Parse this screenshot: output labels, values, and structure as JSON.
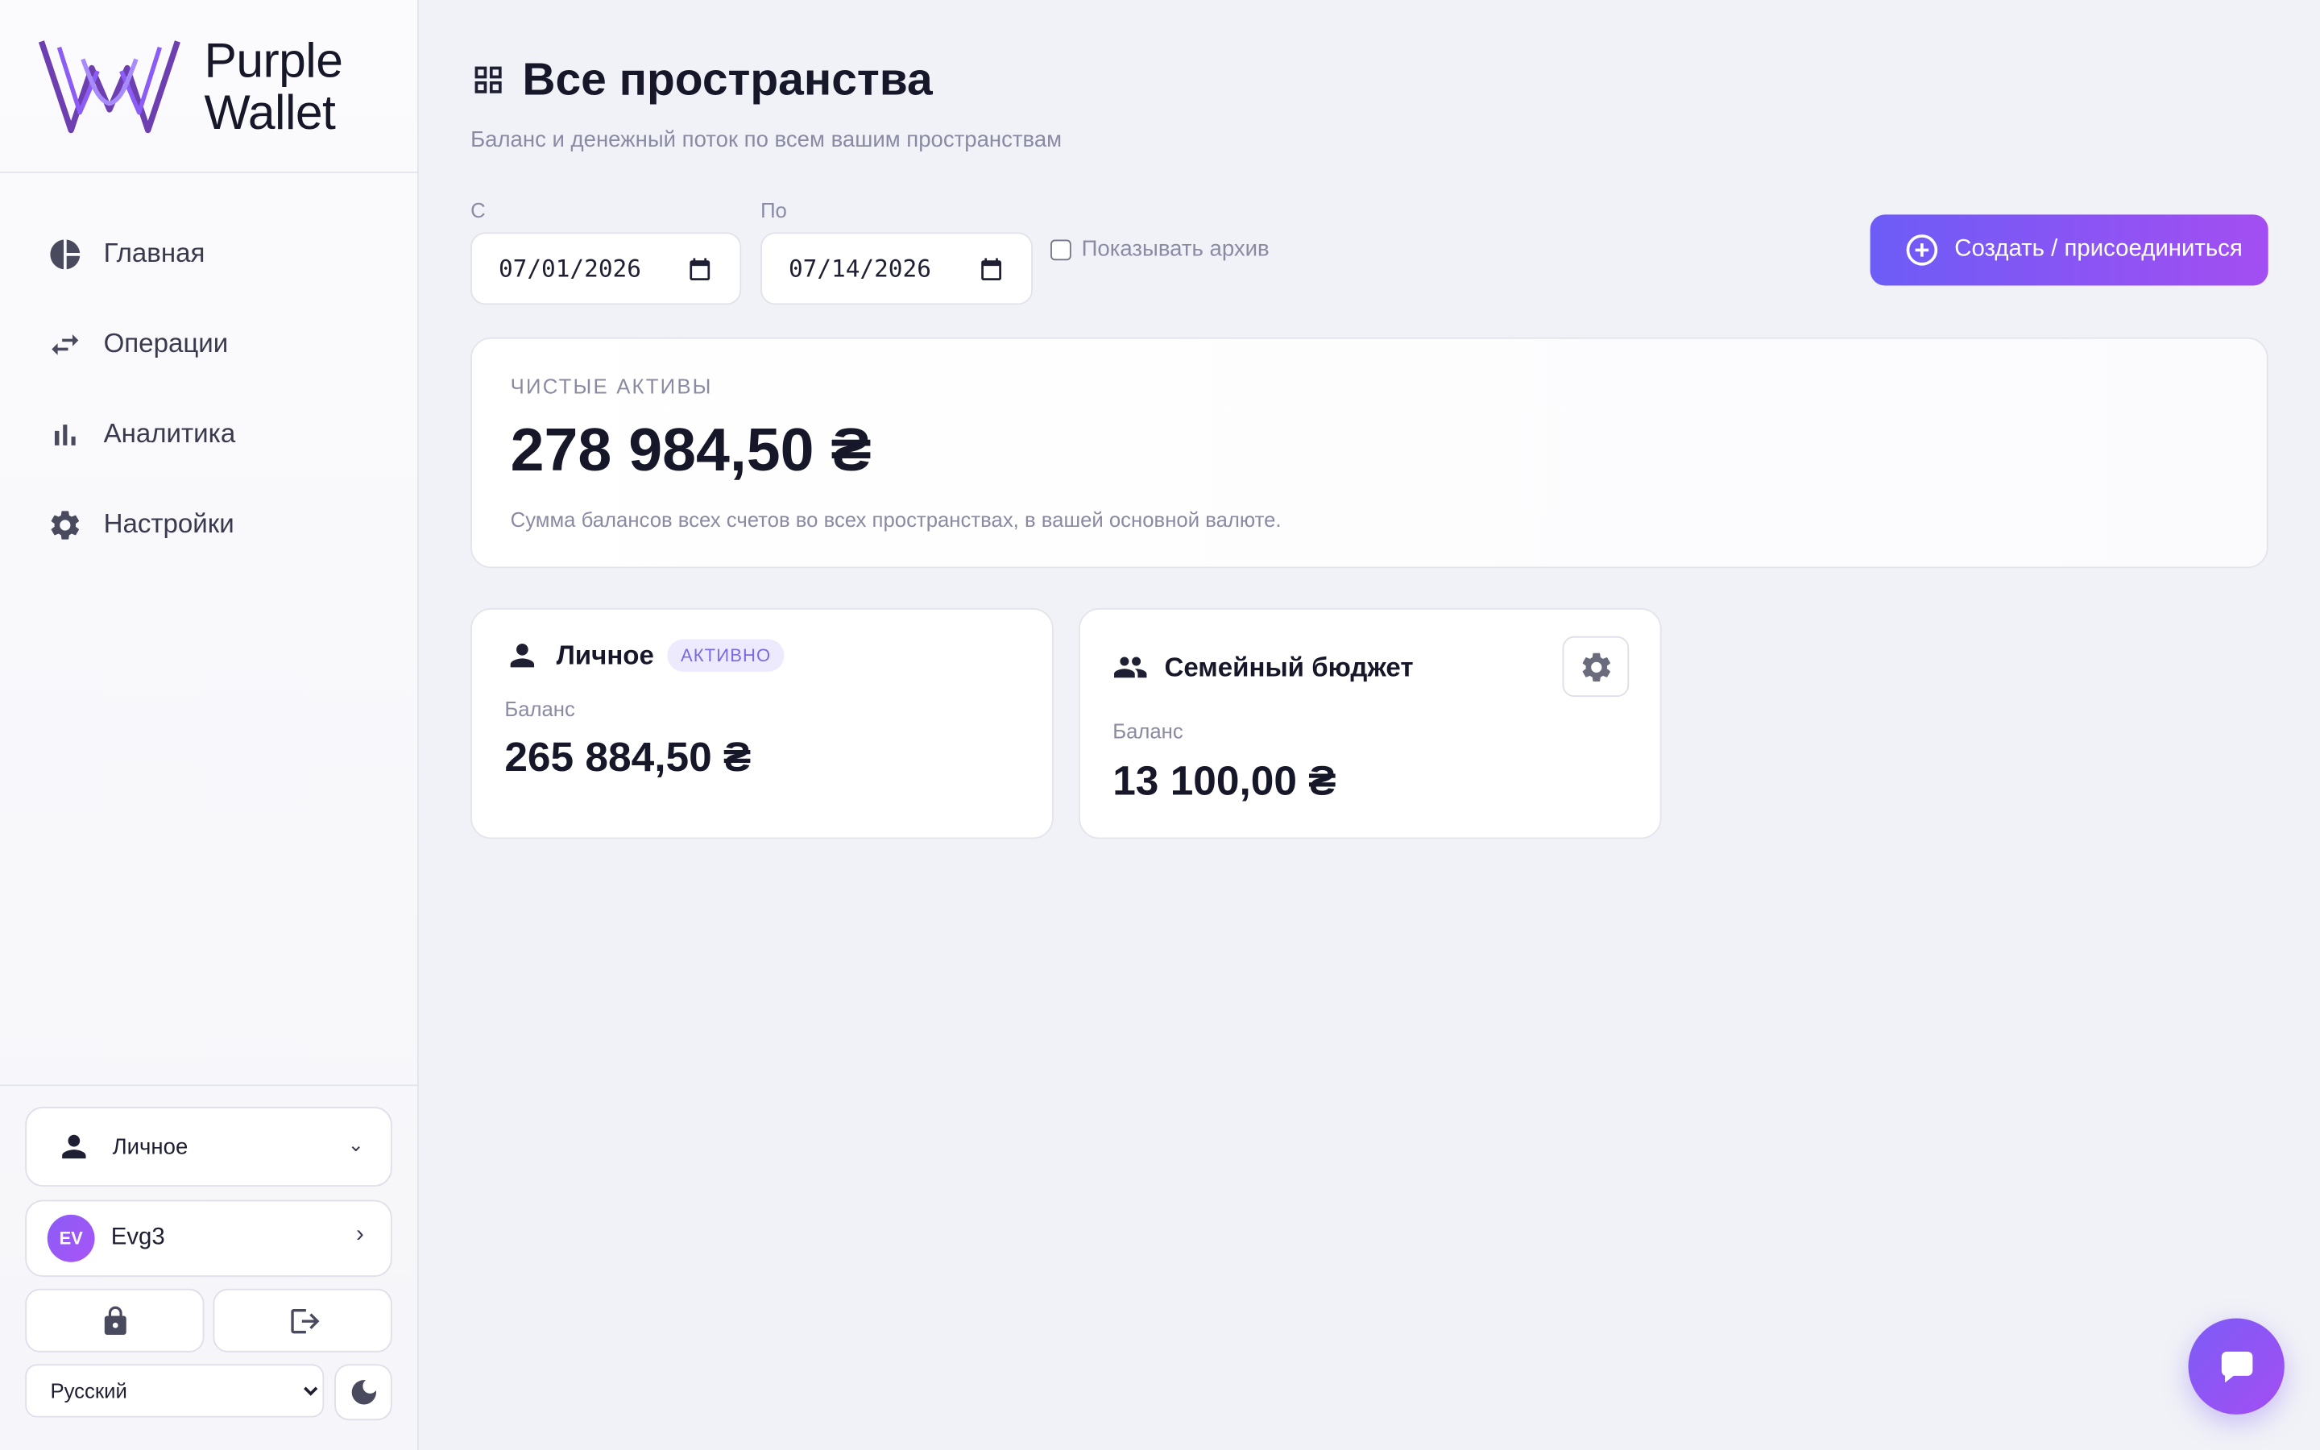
{
  "brand": {
    "line1": "Purple",
    "line2": "Wallet"
  },
  "nav": {
    "items": [
      {
        "label": "Главная",
        "icon": "pie-chart-icon"
      },
      {
        "label": "Операции",
        "icon": "swap-arrows-icon"
      },
      {
        "label": "Аналитика",
        "icon": "bar-chart-icon"
      },
      {
        "label": "Настройки",
        "icon": "gear-icon"
      }
    ]
  },
  "sidebar": {
    "space_select": {
      "label": "Личное"
    },
    "user": {
      "initials": "EV",
      "name": "Evg3"
    },
    "language": {
      "selected": "Русский",
      "options": [
        "Русский"
      ]
    }
  },
  "page": {
    "title": "Все пространства",
    "subtitle": "Баланс и денежный поток по всем вашим пространствам"
  },
  "filters": {
    "from_label": "С",
    "from_value": "07/01/2026",
    "to_label": "По",
    "to_value": "07/14/2026",
    "archive_label": "Показывать архив",
    "archive_checked": false,
    "create_button": "Создать / присоединиться"
  },
  "net_assets": {
    "label": "ЧИСТЫЕ АКТИВЫ",
    "value": "278 984,50 ₴",
    "description": "Сумма балансов всех счетов во всех пространствах, в вашей основной валюте."
  },
  "spaces": [
    {
      "name": "Личное",
      "badge": "АКТИВНО",
      "balance_label": "Баланс",
      "balance": "265 884,50 ₴",
      "icon": "person-icon"
    },
    {
      "name": "Семейный бюджет",
      "badge": "",
      "balance_label": "Баланс",
      "balance": "13 100,00 ₴",
      "icon": "group-icon"
    }
  ],
  "colors": {
    "accent": "#7c5cf6",
    "accent_end": "#a34ef2",
    "badge_bg": "#eeeafd",
    "badge_text": "#7b6ae6"
  }
}
